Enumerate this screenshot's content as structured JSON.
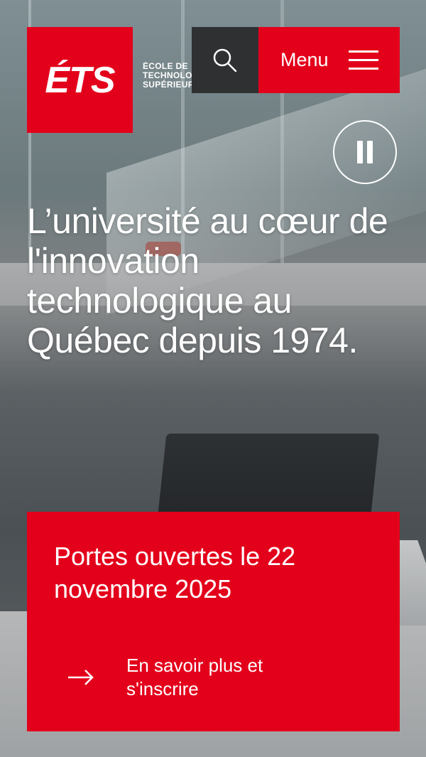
{
  "header": {
    "logo_mark": "ÉTS",
    "logo_text_lines": [
      "ÉCOLE DE",
      "TECHNOLOGIE",
      "SUPÉRIEURE"
    ],
    "search_icon": "search-icon",
    "menu_label": "Menu",
    "menu_icon": "hamburger-icon"
  },
  "hero": {
    "pause_icon": "pause-icon",
    "headline": "L’université au cœur de l'innovation technologique au Québec depuis 1974."
  },
  "promo": {
    "title": "Portes ouvertes le 22 novembre 2025",
    "link_label": "En savoir plus et s'inscrire",
    "link_icon": "arrow-right-icon"
  },
  "colors": {
    "brand_red": "#e3001b",
    "dark_button": "#2f3032",
    "text": "#ffffff"
  }
}
